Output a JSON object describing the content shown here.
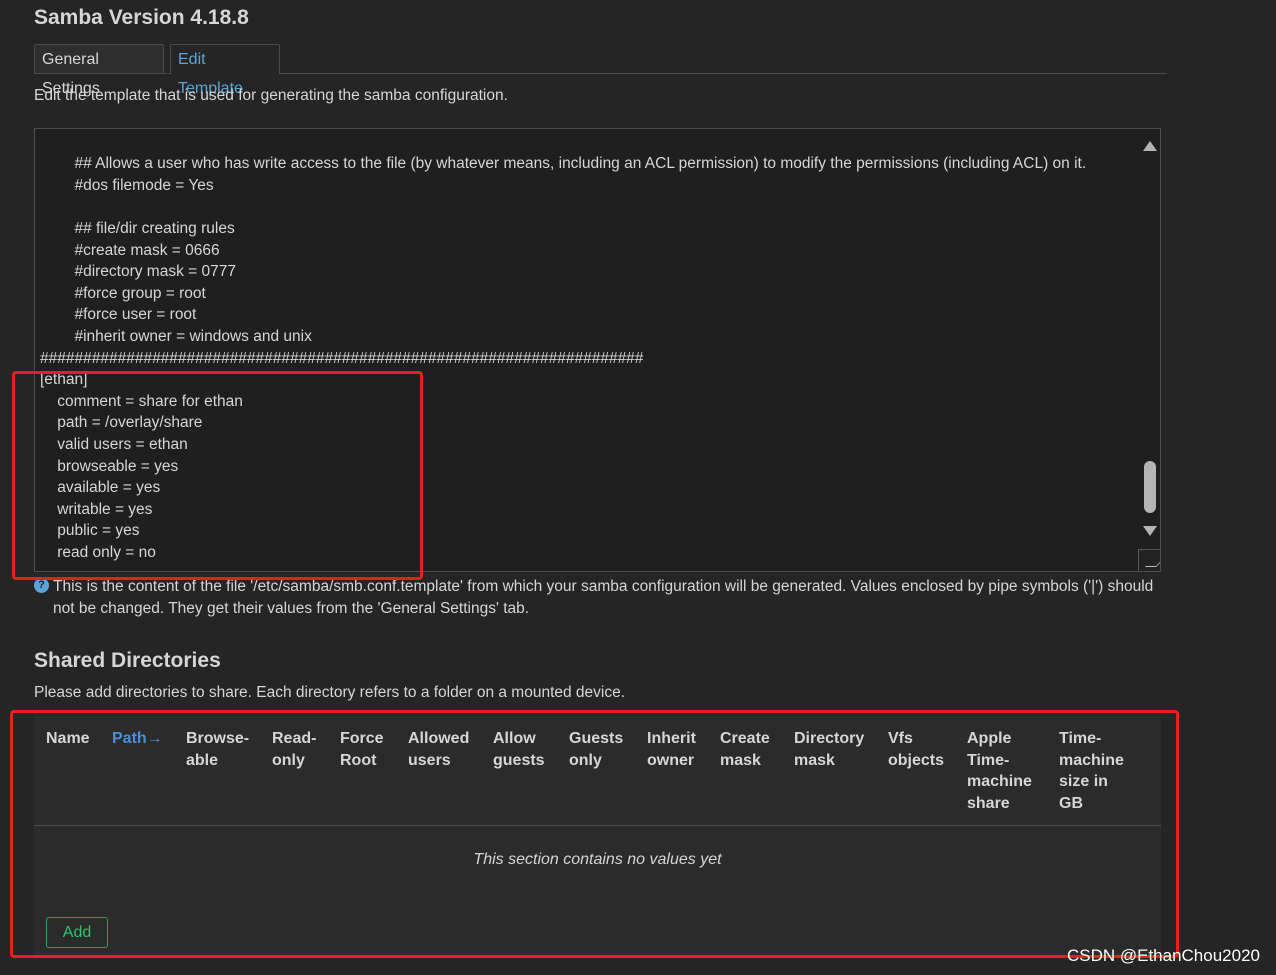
{
  "title": "Samba Version 4.18.8",
  "tabs": [
    {
      "label": "General Settings"
    },
    {
      "label": "Edit Template"
    }
  ],
  "editor": {
    "description": "Edit the template that is used for generating the samba configuration.",
    "content": "        #type\n\n        ## Allows a user who has write access to the file (by whatever means, including an ACL permission) to modify the permissions (including ACL) on it.\n        #dos filemode = Yes\n\n        ## file/dir creating rules\n        #create mask = 0666\n        #directory mask = 0777\n        #force group = root\n        #force user = root\n        #inherit owner = windows and unix\n######################################################################\n[ethan]\n    comment = share for ethan\n    path = /overlay/share\n    valid users = ethan\n    browseable = yes\n    available = yes\n    writable = yes\n    public = yes\n    read only = no",
    "hint": "This is the content of the file '/etc/samba/smb.conf.template' from which your samba configuration will be generated. Values enclosed by pipe symbols ('|') should not be changed. They get their values from the 'General Settings' tab."
  },
  "shared": {
    "title": "Shared Directories",
    "description": "Please add directories to share. Each directory refers to a folder on a mounted device.",
    "columns": [
      {
        "label": "Name"
      },
      {
        "label": "Path→"
      },
      {
        "label": "Browse-\nable"
      },
      {
        "label": "Read-\nonly"
      },
      {
        "label": "Force\nRoot"
      },
      {
        "label": "Allowed\nusers"
      },
      {
        "label": "Allow\nguests"
      },
      {
        "label": "Guests\nonly"
      },
      {
        "label": "Inherit\nowner"
      },
      {
        "label": "Create\nmask"
      },
      {
        "label": "Directory\nmask"
      },
      {
        "label": "Vfs\nobjects"
      },
      {
        "label": "Apple\nTime-\nmachine\nshare"
      },
      {
        "label": "Time-\nmachine\nsize in\nGB"
      }
    ],
    "empty_text": "This section contains no values yet",
    "add_label": "Add"
  },
  "watermark": "CSDN @EthanChou2020",
  "colors": {
    "background": "#252525",
    "accent": "#5aa5d8",
    "add": "#2fbf6f",
    "highlight": "#e32218"
  }
}
